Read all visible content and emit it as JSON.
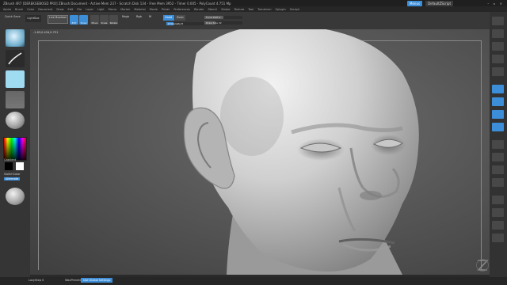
{
  "titlebar": {
    "title": "ZBrush 4R7 [DEREKGEBOGD PRO] ZBrush Document - Active Mem 237 - Scratch Disk 134 - Free Mem 3952 - Timer 0.005 - PolyCount 4.751 Mp",
    "quicksave": "Menus",
    "script": "DefaultZScript",
    "controls": "– ▫ ×"
  },
  "menubar": {
    "items": [
      "Alpha",
      "Brush",
      "Color",
      "Document",
      "Draw",
      "Edit",
      "File",
      "Layer",
      "Light",
      "Macro",
      "Marker",
      "Material",
      "Movie",
      "Picker",
      "Preferences",
      "Render",
      "Stencil",
      "Stroke",
      "Texture",
      "Tool",
      "Transform",
      "Zplugin",
      "Zscript"
    ]
  },
  "shelf": {
    "quicksave_label": "Quick Save",
    "lightbox_label": "LightBox",
    "brush_label": "Live Boolean",
    "mode_edit": "Edit",
    "mode_draw": "Draw",
    "mode_move": "Move",
    "mode_scale": "Scale",
    "mode_rotate": "Rotate",
    "mrgb": "Mrgb",
    "rgb": "Rgb",
    "m": "M",
    "zadd": "Zadd",
    "zsub": "Zsub",
    "zint_label": "Z Intensity 8",
    "zint_value": 0.18,
    "focal_label": "Focal Shift 0",
    "draw_size_label": "Draw Size 32"
  },
  "canvas": {
    "coords": "-1.63,0.434,0.751"
  },
  "lefttray": {
    "gradient_label": "Gradient",
    "switchcolor_label": "SwitchColor",
    "alternate_label": "Alternate"
  },
  "bottombar": {
    "lazy_label": "LazyStep 0",
    "wax_label": "WaxPreview",
    "global_label": "Use Global Settings"
  },
  "colors": {
    "accent": "#3d8ed8",
    "background": "#2a2a2a",
    "panel": "#383838"
  }
}
